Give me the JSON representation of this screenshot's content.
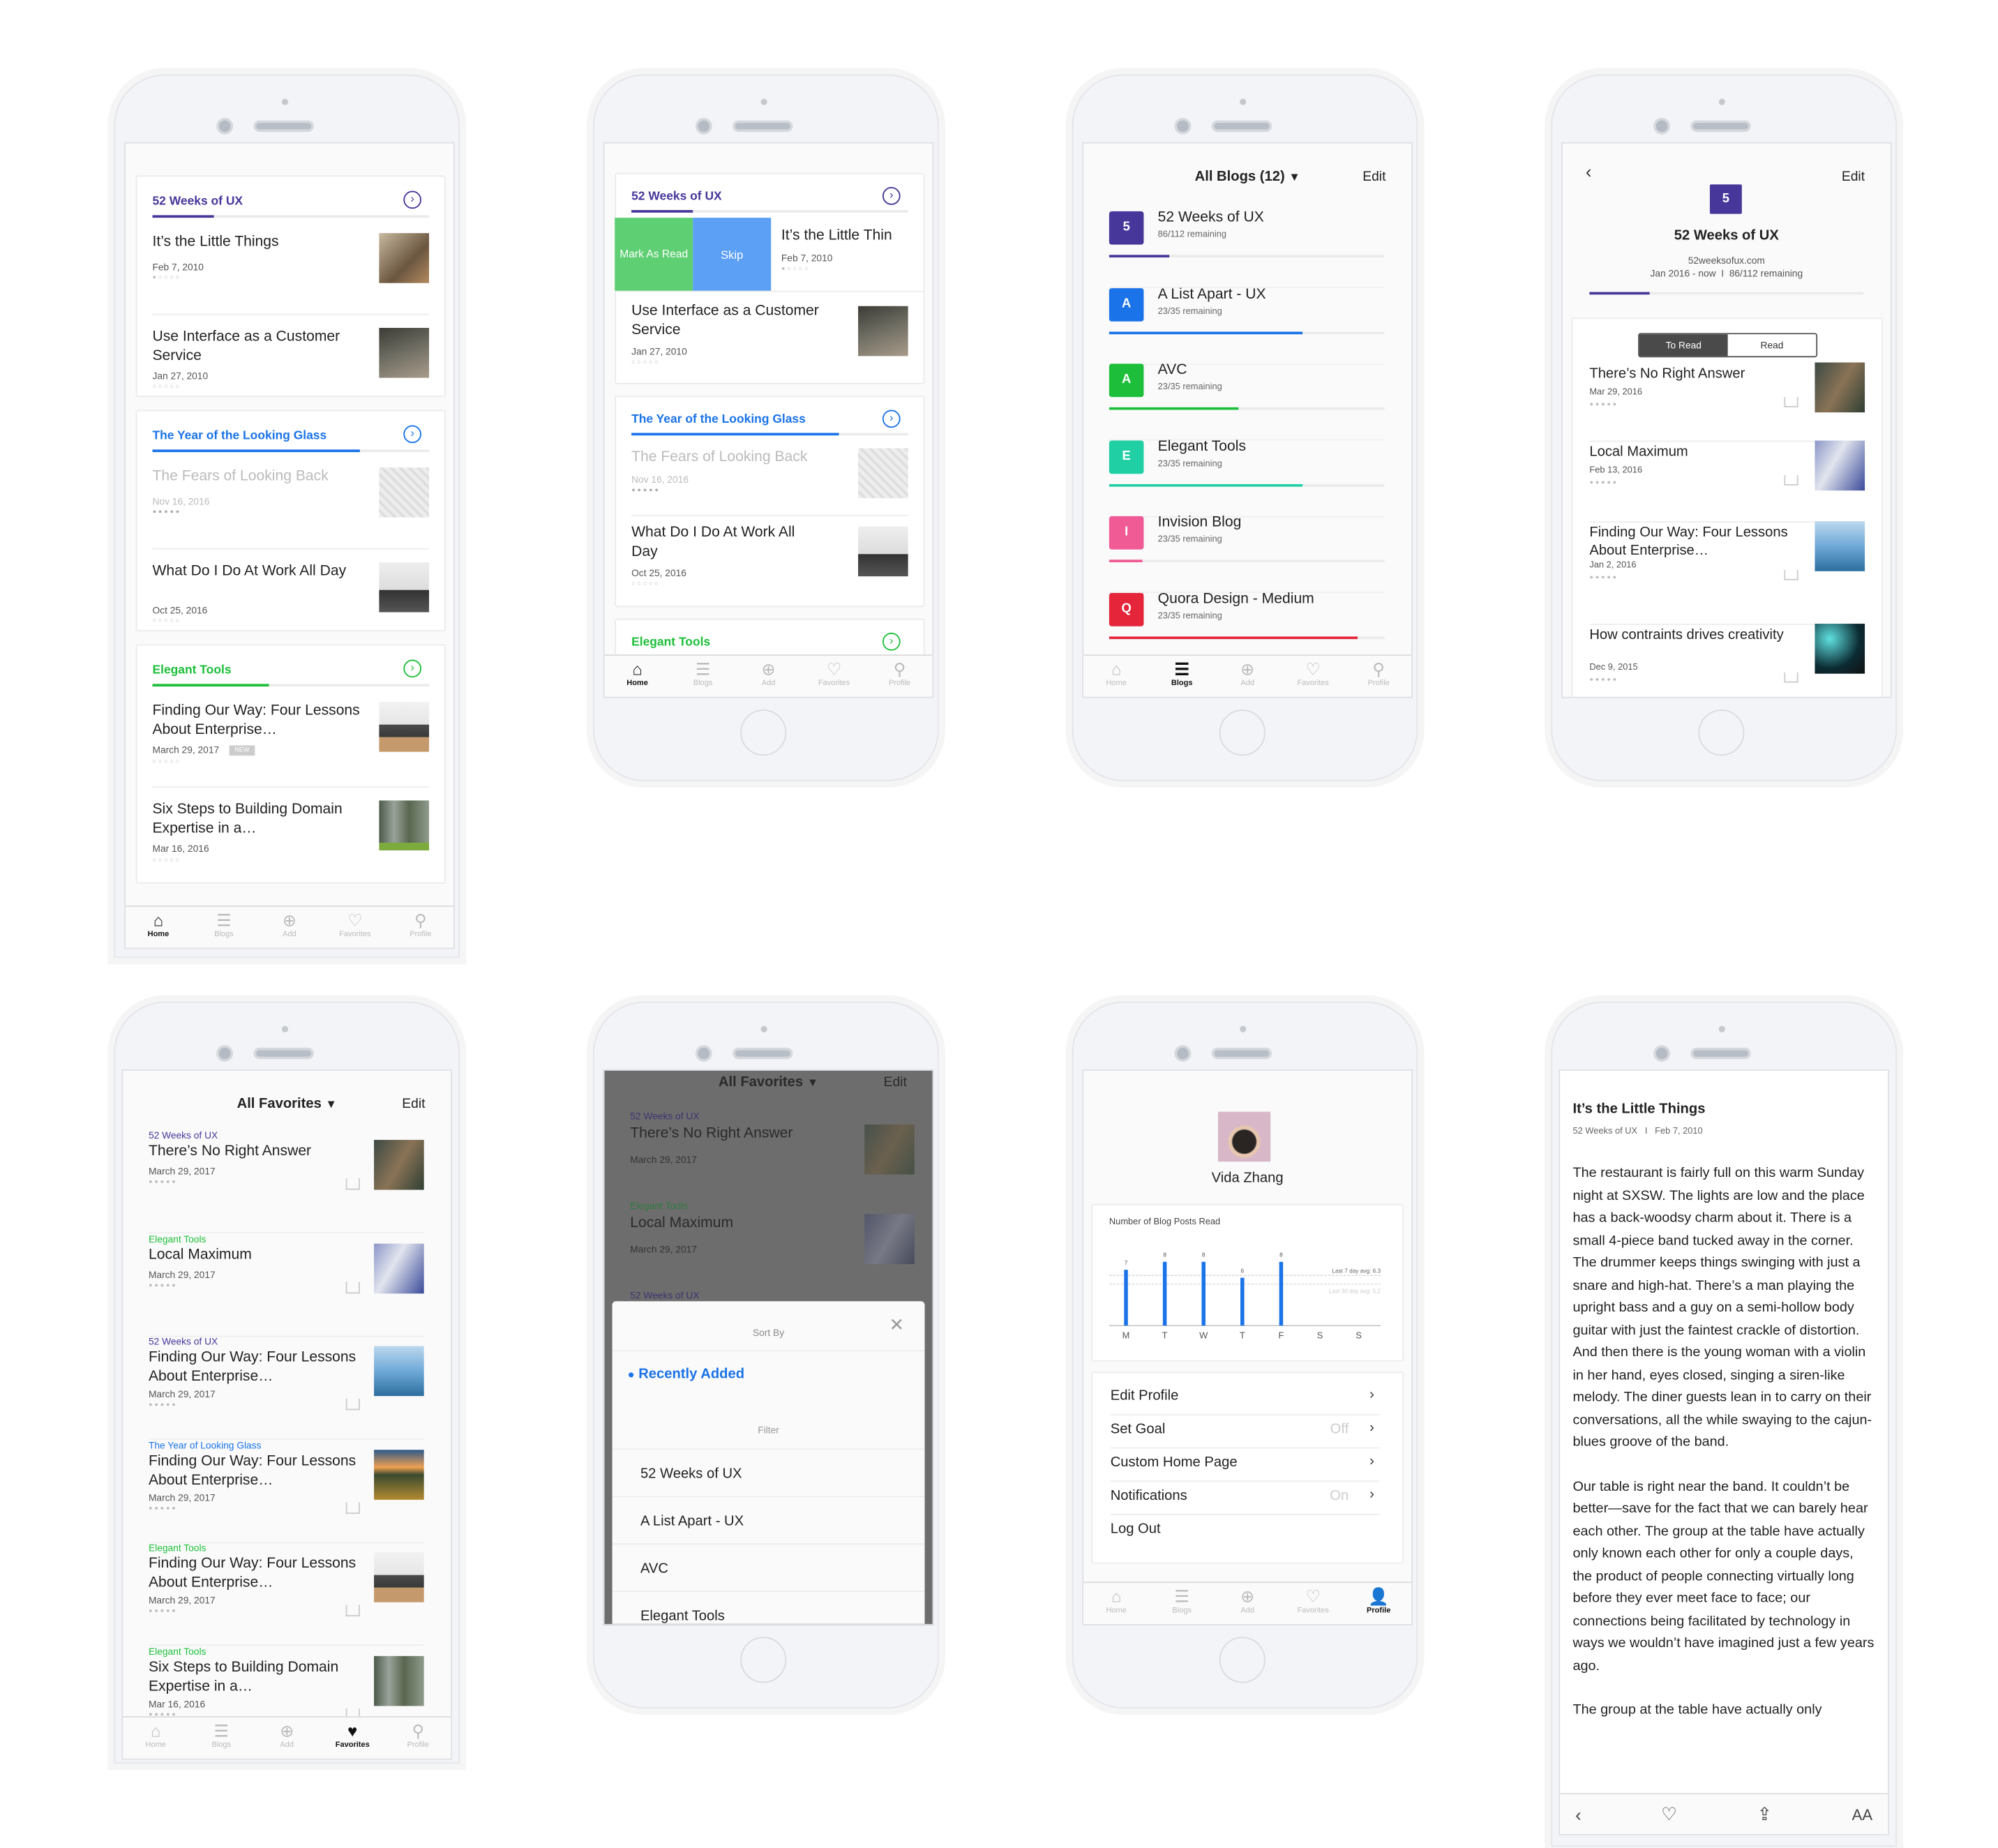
{
  "colors": {
    "purple": "#47379a",
    "blue": "#1a73e8",
    "green": "#1dbf3a",
    "teal": "#20d0a4",
    "pink": "#f05a95",
    "red": "#e5253a",
    "swipe_green": "#5ecf72",
    "swipe_blue": "#5ba0f5"
  },
  "tabbar": [
    "Home",
    "Blogs",
    "Add",
    "Favorites",
    "Profile"
  ],
  "home": {
    "sections": [
      {
        "title": "52 Weeks of UX",
        "progress": 0.22,
        "posts": [
          {
            "title": "It’s the Little Things",
            "date": "Feb 7, 2010",
            "dots": "●○○○○"
          },
          {
            "title": "Use Interface as a Customer Service",
            "date": "Jan 27, 2010",
            "dots": "○○○○○"
          }
        ]
      },
      {
        "title": "The Year of the Looking Glass",
        "progress": 0.75,
        "posts": [
          {
            "title": "The Fears of Looking Back",
            "date": "Nov 16, 2016",
            "dots": "●●●●●"
          },
          {
            "title": "What Do I Do At Work All Day",
            "date": "Oct 25, 2016",
            "dots": "○○○○○"
          }
        ]
      },
      {
        "title": "Elegant Tools",
        "progress": 0.42,
        "posts": [
          {
            "title": "Finding Our Way: Four Lessons About Enterprise…",
            "date": "March 29, 2017",
            "badge": "NEW",
            "dots": "○○○○○"
          },
          {
            "title": "Six Steps to Building Domain Expertise in a…",
            "date": "Mar 16, 2016",
            "dots": "○○○○○"
          }
        ]
      }
    ]
  },
  "swipe": {
    "mark_read": "Mark As Read",
    "skip": "Skip",
    "truncated_title": "It’s the Little Thin"
  },
  "blogs": {
    "title": "All Blogs (12)",
    "edit": "Edit",
    "items": [
      {
        "letter": "5",
        "name": "52 Weeks of UX",
        "remaining": "86/112 remaining",
        "progress": 0.22
      },
      {
        "letter": "A",
        "name": "A List Apart - UX",
        "remaining": "23/35 remaining",
        "progress": 0.7
      },
      {
        "letter": "A",
        "name": "AVC",
        "remaining": "23/35 remaining",
        "progress": 0.47
      },
      {
        "letter": "E",
        "name": "Elegant Tools",
        "remaining": "23/35 remaining",
        "progress": 0.7
      },
      {
        "letter": "I",
        "name": "Invision Blog",
        "remaining": "23/35 remaining",
        "progress": 0.12
      },
      {
        "letter": "Q",
        "name": "Quora Design - Medium",
        "remaining": "23/35 remaining",
        "progress": 0.9
      }
    ]
  },
  "blog_detail": {
    "edit": "Edit",
    "letter": "5",
    "name": "52 Weeks of UX",
    "url": "52weeksofux.com",
    "meta": "Jan 2016 - now  I  86/112 remaining",
    "progress": 0.22,
    "seg_to_read": "To Read",
    "seg_read": "Read",
    "posts": [
      {
        "title": "There’s No Right Answer",
        "date": "Mar 29, 2016"
      },
      {
        "title": "Local Maximum",
        "date": "Feb 13, 2016"
      },
      {
        "title": "Finding Our Way: Four Lessons About Enterprise…",
        "date": "Jan 2, 2016"
      },
      {
        "title": "How contraints drives creativity",
        "date": "Dec 9, 2015"
      }
    ]
  },
  "favorites": {
    "title": "All Favorites",
    "edit": "Edit",
    "items": [
      {
        "source": "52 Weeks of UX",
        "color": "purple",
        "title": "There’s No Right Answer",
        "date": "March 29, 2017"
      },
      {
        "source": "Elegant Tools",
        "color": "green",
        "title": "Local Maximum",
        "date": "March 29, 2017"
      },
      {
        "source": "52 Weeks of UX",
        "color": "purple",
        "title": "Finding Our Way: Four Lessons About Enterprise…",
        "date": "March 29, 2017"
      },
      {
        "source": "The Year of Looking Glass",
        "color": "blue",
        "title": "Finding Our Way: Four Lessons About Enterprise…",
        "date": "March 29, 2017"
      },
      {
        "source": "Elegant Tools",
        "color": "green",
        "title": "Finding Our Way: Four Lessons About Enterprise…",
        "date": "March 29, 2017"
      },
      {
        "source": "Elegant Tools",
        "color": "green",
        "title": "Six Steps to Building Domain Expertise in a…",
        "date": "Mar 16, 2016"
      }
    ]
  },
  "sort_modal": {
    "sort_by": "Sort By",
    "selected": "Recently Added",
    "filter": "Filter",
    "options": [
      "52 Weeks of UX",
      "A List Apart - UX",
      "AVC",
      "Elegant Tools"
    ]
  },
  "profile": {
    "name": "Vida Zhang",
    "menu": [
      {
        "label": "Edit Profile",
        "value": ""
      },
      {
        "label": "Set Goal",
        "value": "Off"
      },
      {
        "label": "Custom Home Page",
        "value": ""
      },
      {
        "label": "Notifications",
        "value": "On"
      },
      {
        "label": "Log Out",
        "value": "",
        "no_chevron": true
      }
    ]
  },
  "chart_data": {
    "type": "bar",
    "title": "Number of Blog Posts Read",
    "categories": [
      "M",
      "T",
      "W",
      "T",
      "F",
      "S",
      "S"
    ],
    "values": [
      7,
      8,
      8,
      6,
      8,
      null,
      null
    ],
    "ylim": [
      0,
      9
    ],
    "reference_lines": [
      {
        "label": "Last 7 day avg: 6.3",
        "value": 6.3
      },
      {
        "label": "Last 30 day avg: 5.2",
        "value": 5.2
      }
    ],
    "color": "#1a73e8",
    "grid": false
  },
  "article": {
    "title": "It’s the Little Things",
    "meta": "52 Weeks of UX   I   Feb 7, 2010",
    "paragraphs": [
      "The restaurant is fairly full on this warm Sunday night at SXSW. The lights are low and the place has a back-woodsy charm about it. There is a small 4-piece band tucked away in the corner. The drummer keeps things swinging with just a snare and high-hat. There’s a man playing the upright bass and a guy on a semi-hollow body guitar with just the faintest crackle of distortion. And then there is the young woman with a violin in her hand, eyes closed, singing a siren-like melody. The diner guests lean in to carry on their conversations, all the while swaying to the cajun-blues groove of the band.",
      "Our table is right near the band. It couldn’t be better—save for the fact that we can barely hear each other. The group at the table have actually only known each other for only a couple days, the product of people connecting virtually long before they ever meet face to face; our connections being facilitated by technology in ways we wouldn’t have imagined just a few years ago.",
      "The group at the table have actually only"
    ],
    "font_label": "AA"
  }
}
